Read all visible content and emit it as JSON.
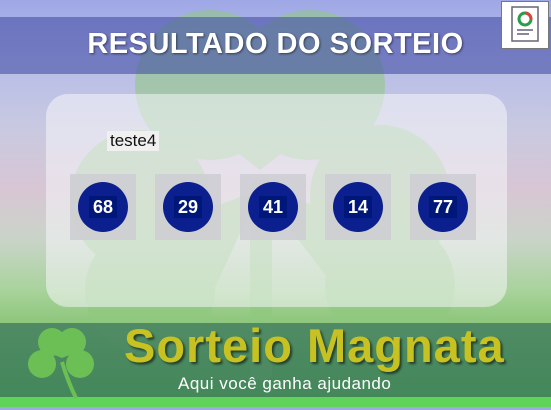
{
  "header": {
    "title": "RESULTADO DO SORTEIO"
  },
  "card": {
    "label": "teste4"
  },
  "balls": [
    "68",
    "29",
    "41",
    "14",
    "77"
  ],
  "footer": {
    "brand": "Sorteio Magnata",
    "tagline": "Aqui você ganha ajudando"
  },
  "colors": {
    "ball": "#0b1f8f",
    "brand": "#c7c221",
    "clover": "#8dc77f"
  },
  "icons": {
    "corner": "document-chart-icon",
    "footer": "clover-icon"
  }
}
